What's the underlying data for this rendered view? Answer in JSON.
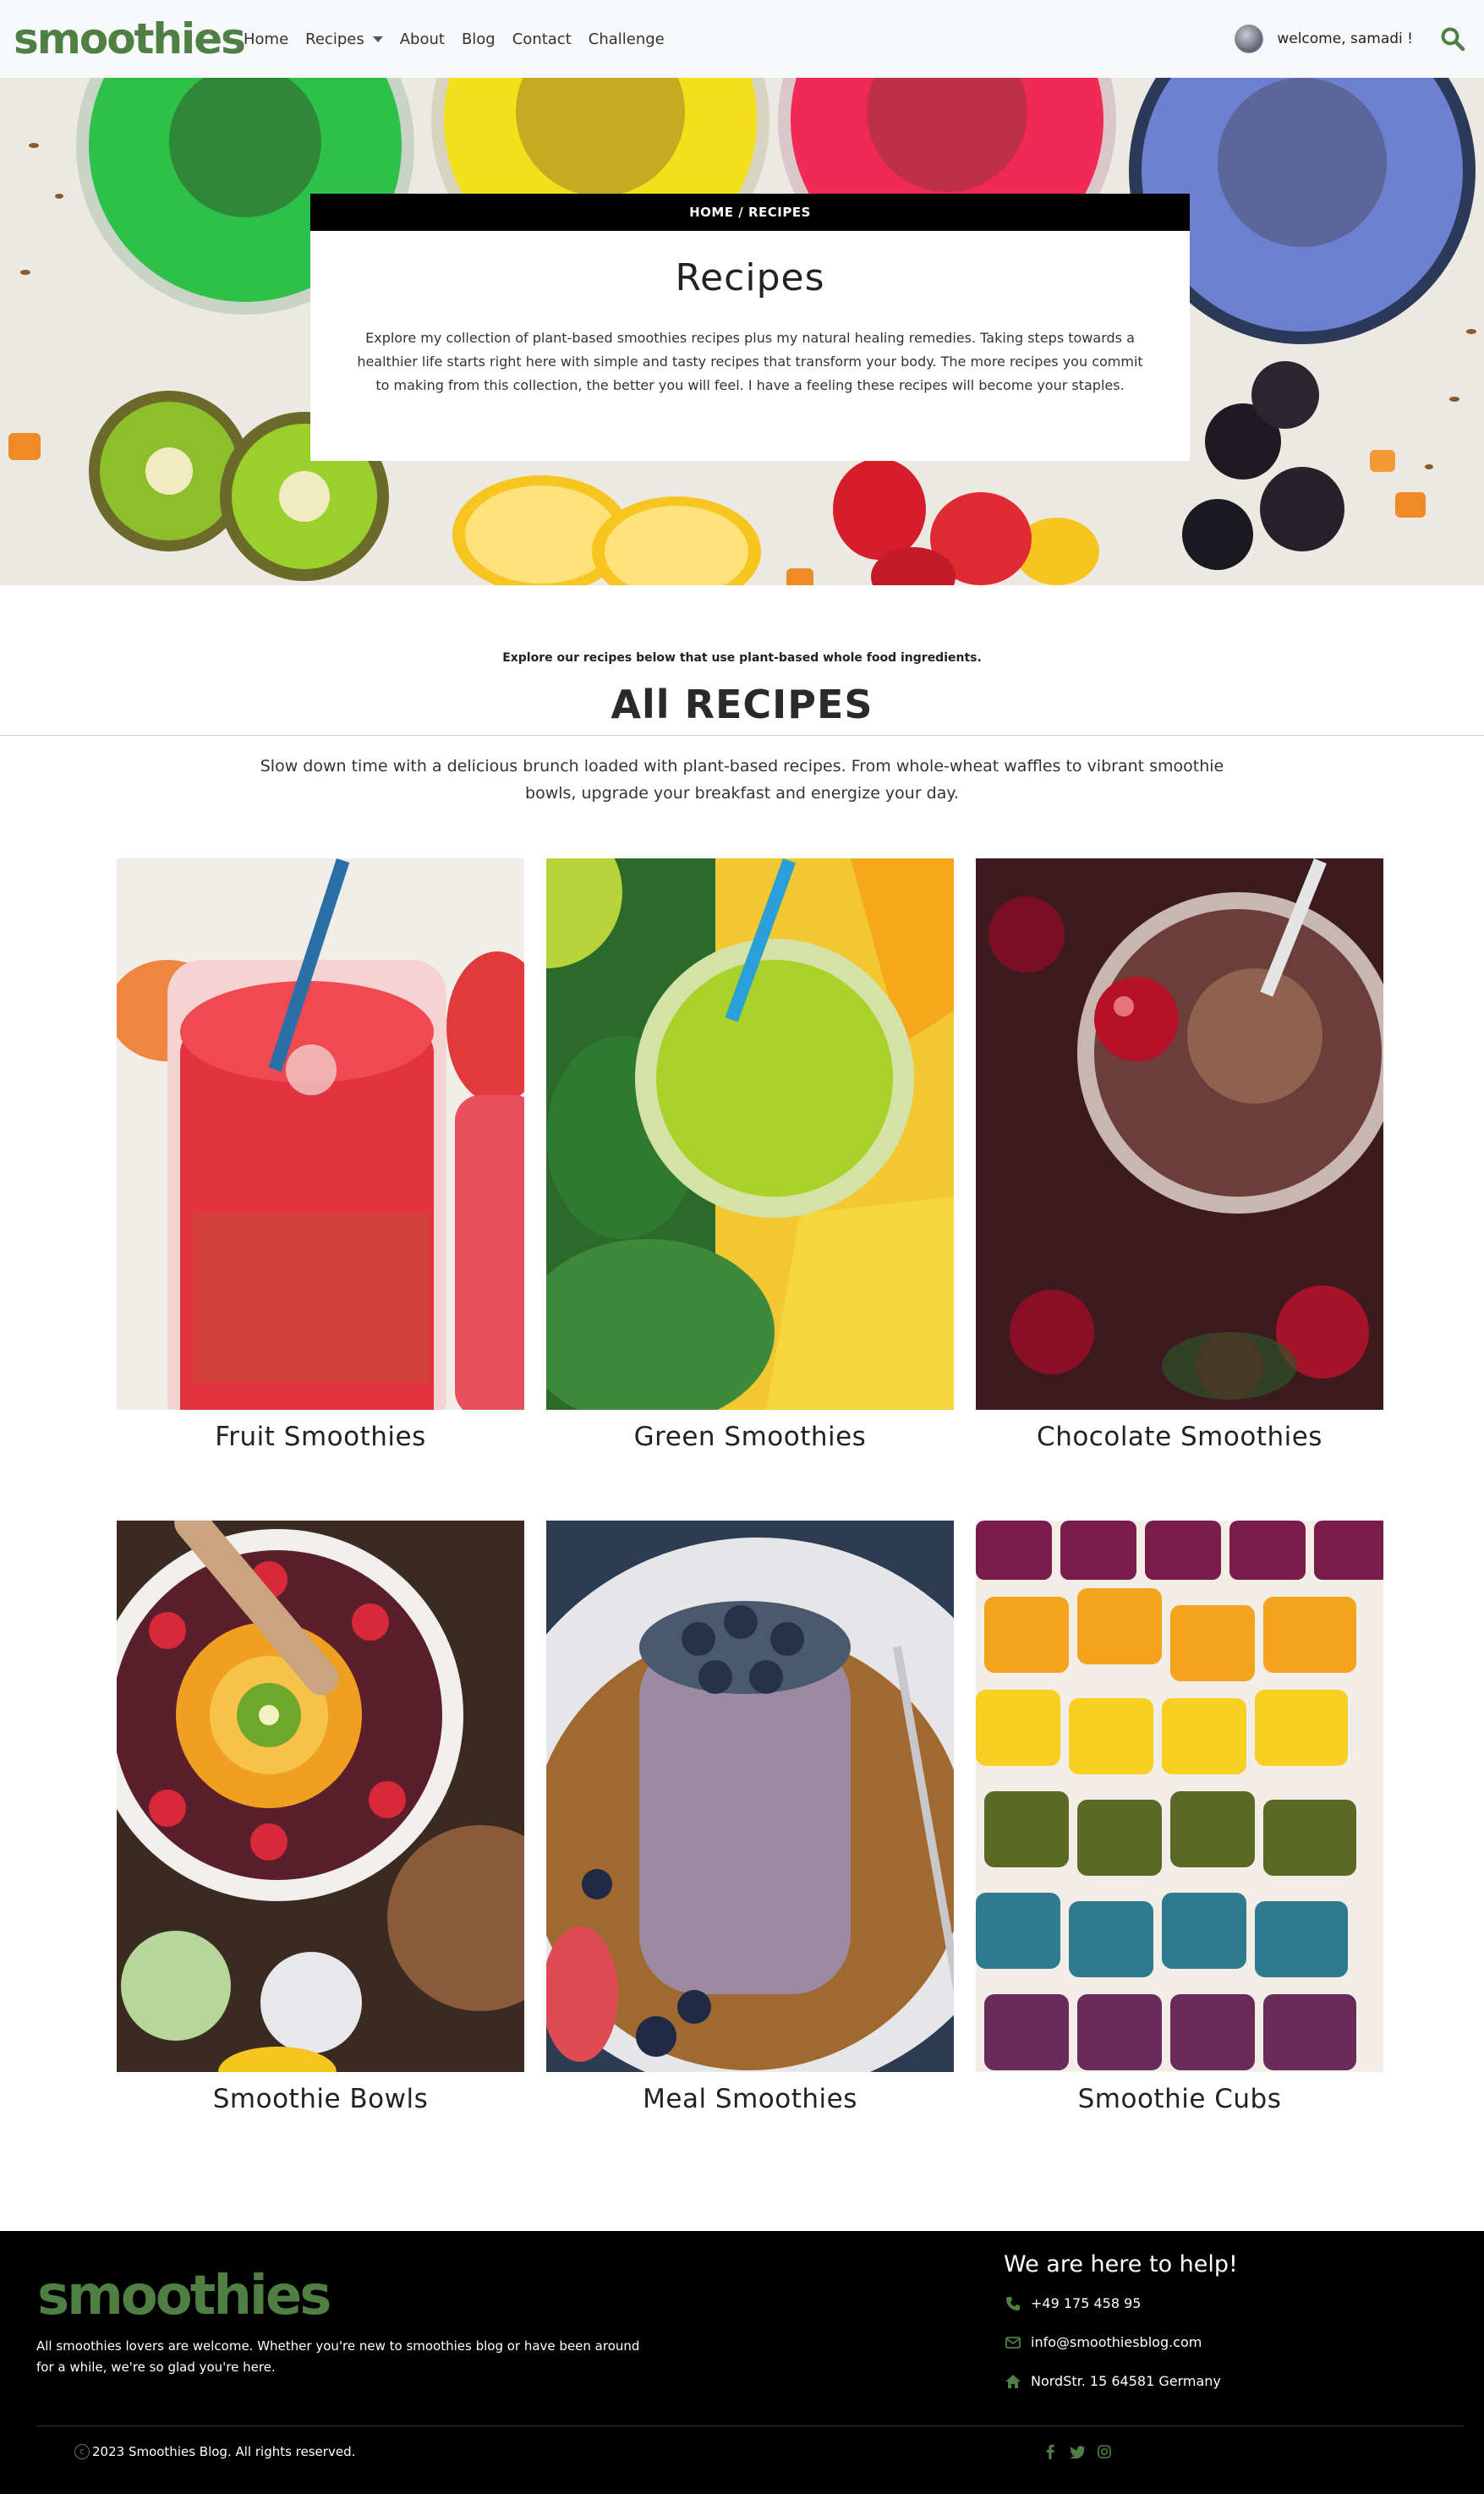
{
  "brand": {
    "logo_text": "smoothies"
  },
  "nav": {
    "items": [
      {
        "label": "Home"
      },
      {
        "label": "Recipes"
      },
      {
        "label": "About"
      },
      {
        "label": "Blog"
      },
      {
        "label": "Contact"
      },
      {
        "label": "Challenge"
      }
    ],
    "welcome": "welcome, samadi !"
  },
  "hero": {
    "breadcrumb": "HOME / RECIPES",
    "title": "Recipes",
    "description": "Explore my collection of plant-based smoothies recipes plus my natural healing remedies. Taking steps towards a healthier life starts right here with simple and tasty recipes that transform your body. The more recipes you commit to making from this collection, the better you will feel. I have a feeling these recipes will become your staples."
  },
  "section": {
    "kicker": "Explore our recipes below that use plant-based whole food ingredients.",
    "title": "All RECIPES",
    "description": "Slow down time with a delicious brunch loaded with plant-based recipes. From whole-wheat waffles to vibrant smoothie bowls, upgrade your breakfast and energize your day."
  },
  "recipes": [
    {
      "label": "Fruit Smoothies"
    },
    {
      "label": "Green Smoothies"
    },
    {
      "label": "Chocolate Smoothies"
    },
    {
      "label": "Smoothie Bowls"
    },
    {
      "label": "Meal Smoothies"
    },
    {
      "label": "Smoothie Cubs"
    }
  ],
  "footer": {
    "logo_text": "smoothies",
    "text": "All smoothies lovers are welcome. Whether you're new to smoothies blog or have been around for a while, we're so glad you're here.",
    "help_title": "We are here to help!",
    "phone": "+49 175 458 95",
    "email": "info@smoothiesblog.com",
    "address": "NordStr. 15 64581 Germany",
    "copyright": "2023 Smoothies Blog. All rights reserved.",
    "social": [
      "facebook-icon",
      "twitter-icon",
      "instagram-icon"
    ]
  },
  "colors": {
    "brand_green": "#4f7f43",
    "navbar_bg": "#f7f8fa",
    "footer_bg": "#000000"
  }
}
